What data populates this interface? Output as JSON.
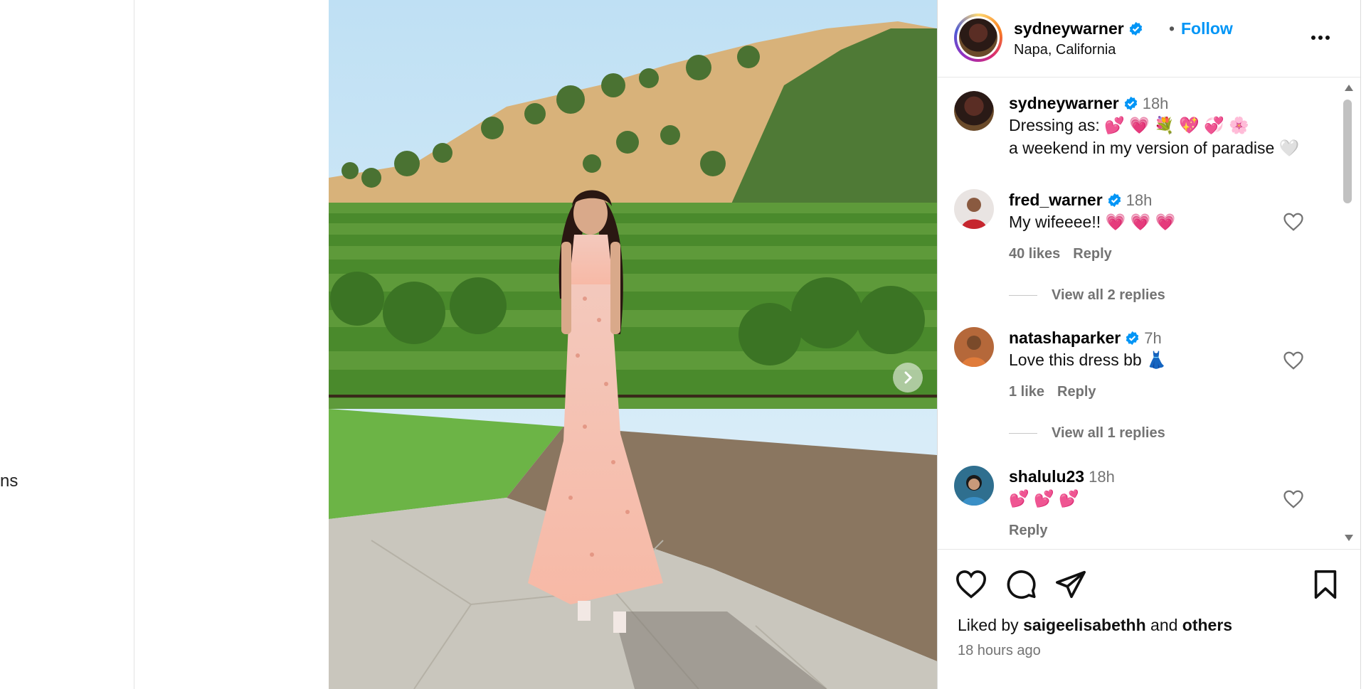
{
  "left": {
    "fragment_text": "ns"
  },
  "post": {
    "username": "sydneywarner",
    "location": "Napa, California",
    "follow_label": "Follow",
    "separator": "•",
    "caption_time": "18h",
    "caption_line1": "Dressing as: 💕 💗 💐 💖 💞 🌸",
    "caption_line2": "a weekend in my version of paradise 🤍"
  },
  "comments": [
    {
      "username": "fred_warner",
      "verified": true,
      "time": "18h",
      "text": "My wifeeee!! 💗 💗 💗",
      "likes": "40 likes",
      "reply_label": "Reply",
      "view_replies": "View all 2 replies"
    },
    {
      "username": "natashaparker",
      "verified": true,
      "time": "7h",
      "text": "Love this dress bb 👗",
      "likes": "1 like",
      "reply_label": "Reply",
      "view_replies": "View all 1 replies"
    },
    {
      "username": "shalulu23",
      "verified": false,
      "time": "18h",
      "text": "💕 💕 💕",
      "reply_label": "Reply"
    }
  ],
  "footer": {
    "liked_prefix": "Liked by",
    "liked_user": "saigeelisabethh",
    "liked_and": "and",
    "liked_others": "others",
    "time_ago": "18 hours ago"
  },
  "colors": {
    "accent": "#0095f6",
    "verified": "#0095f6",
    "muted": "#737373"
  },
  "icons": [
    "verified-badge-icon",
    "more-options-icon",
    "heart-icon",
    "comment-icon",
    "share-icon",
    "save-icon",
    "chevron-right-icon",
    "scroll-up-icon",
    "scroll-down-icon"
  ]
}
